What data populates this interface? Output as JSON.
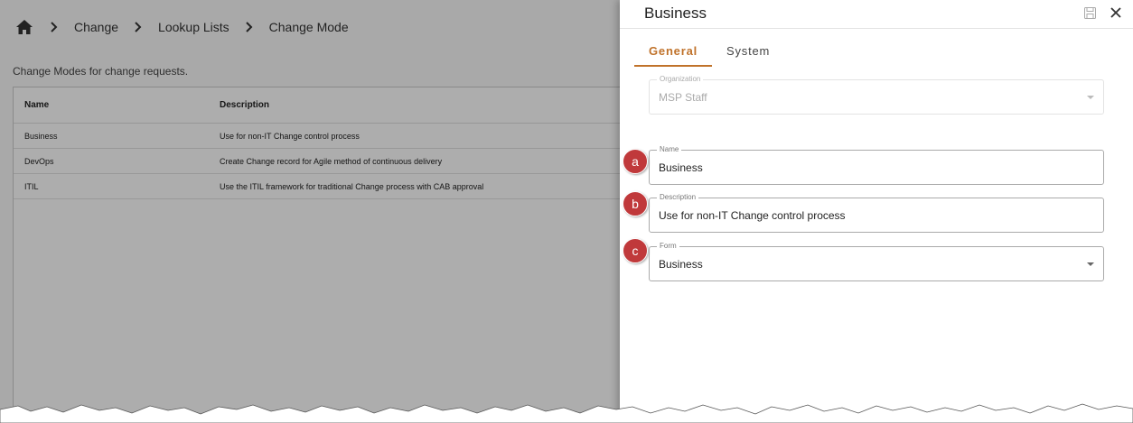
{
  "breadcrumb": {
    "items": [
      "Change",
      "Lookup Lists",
      "Change Mode"
    ]
  },
  "page": {
    "subtitle": "Change Modes for change requests."
  },
  "table": {
    "headers": [
      "Name",
      "Description"
    ],
    "rows": [
      {
        "name": "Business",
        "description": "Use for non-IT Change control process"
      },
      {
        "name": "DevOps",
        "description": "Create Change record for Agile method of continuous delivery"
      },
      {
        "name": "ITIL",
        "description": "Use the ITIL framework for traditional Change process with CAB approval"
      }
    ]
  },
  "panel": {
    "title": "Business",
    "tabs": [
      "General",
      "System"
    ],
    "fields": {
      "organization": {
        "label": "Organization",
        "value": "MSP Staff"
      },
      "name": {
        "label": "Name",
        "value": "Business"
      },
      "description": {
        "label": "Description",
        "value": "Use for non-IT Change control process"
      },
      "form": {
        "label": "Form",
        "value": "Business"
      }
    },
    "callouts": [
      "a",
      "b",
      "c"
    ]
  },
  "colors": {
    "accent": "#c0722a",
    "callout": "#c0393b"
  }
}
